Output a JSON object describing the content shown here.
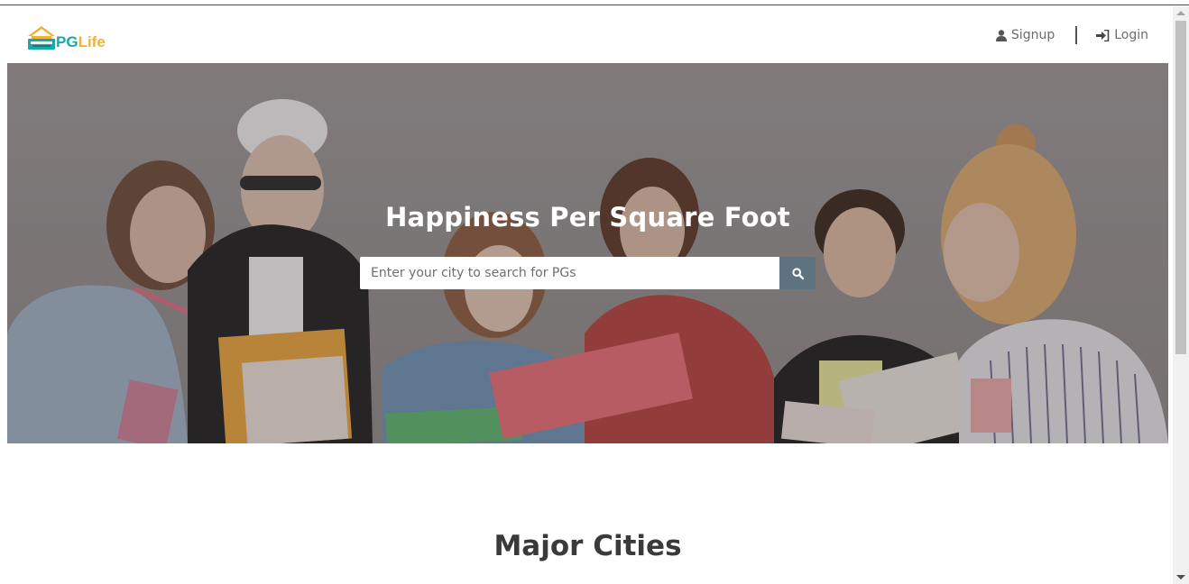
{
  "brand": {
    "logo_pg": "PG",
    "logo_life": "Life",
    "colors": {
      "teal": "#1ba7ab",
      "orange": "#f4b130"
    }
  },
  "nav": {
    "signup_label": "Signup",
    "login_label": "Login",
    "signup_icon": "user-icon",
    "login_icon": "sign-in-icon"
  },
  "hero": {
    "title": "Happiness Per Square Foot",
    "search_placeholder": "Enter your city to search for PGs",
    "search_icon": "search-icon",
    "search_button_color": "#5f7280"
  },
  "section": {
    "title": "Major Cities"
  }
}
